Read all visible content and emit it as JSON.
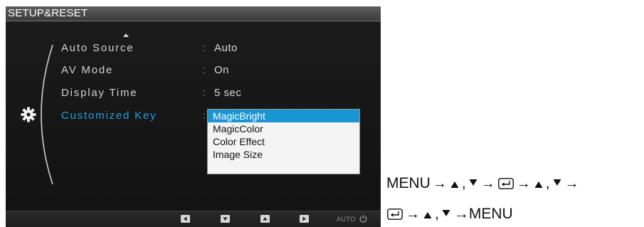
{
  "osd": {
    "title": "SETUP&RESET",
    "section_icon": "gear-icon",
    "scroll_up_icon": "triangle-up-icon",
    "items": [
      {
        "label": "Auto Source",
        "value": "Auto",
        "active": false
      },
      {
        "label": "AV Mode",
        "value": "On",
        "active": false
      },
      {
        "label": "Display Time",
        "value": "5 sec",
        "active": false
      },
      {
        "label": "Customized Key",
        "value": "",
        "active": true
      }
    ],
    "separator": ":",
    "dropdown": {
      "options": [
        "MagicBright",
        "MagicColor",
        "Color Effect",
        "Image Size"
      ],
      "selected": "MagicBright"
    },
    "bottom_bar": {
      "buttons": [
        "left-button-icon",
        "down-button-icon",
        "up-button-icon",
        "right-button-icon"
      ],
      "auto_label": "AUTO",
      "power_icon": "power-icon"
    },
    "colors": {
      "active_text": "#1fa2e0",
      "dropdown_selected_bg": "#1a95d4",
      "panel_bg": "#181818"
    }
  },
  "instructions": {
    "line1": [
      "MENU",
      "→",
      "▲",
      ",",
      "▼",
      "→",
      "enter-icon",
      "→",
      "▲",
      ",",
      "▼",
      "→"
    ],
    "line2": [
      "enter-icon",
      "→",
      "▲",
      ",",
      "▼",
      "→MENU"
    ],
    "menu_label": "MENU",
    "arrow": "→",
    "comma": ",",
    "end_text": "→MENU"
  }
}
